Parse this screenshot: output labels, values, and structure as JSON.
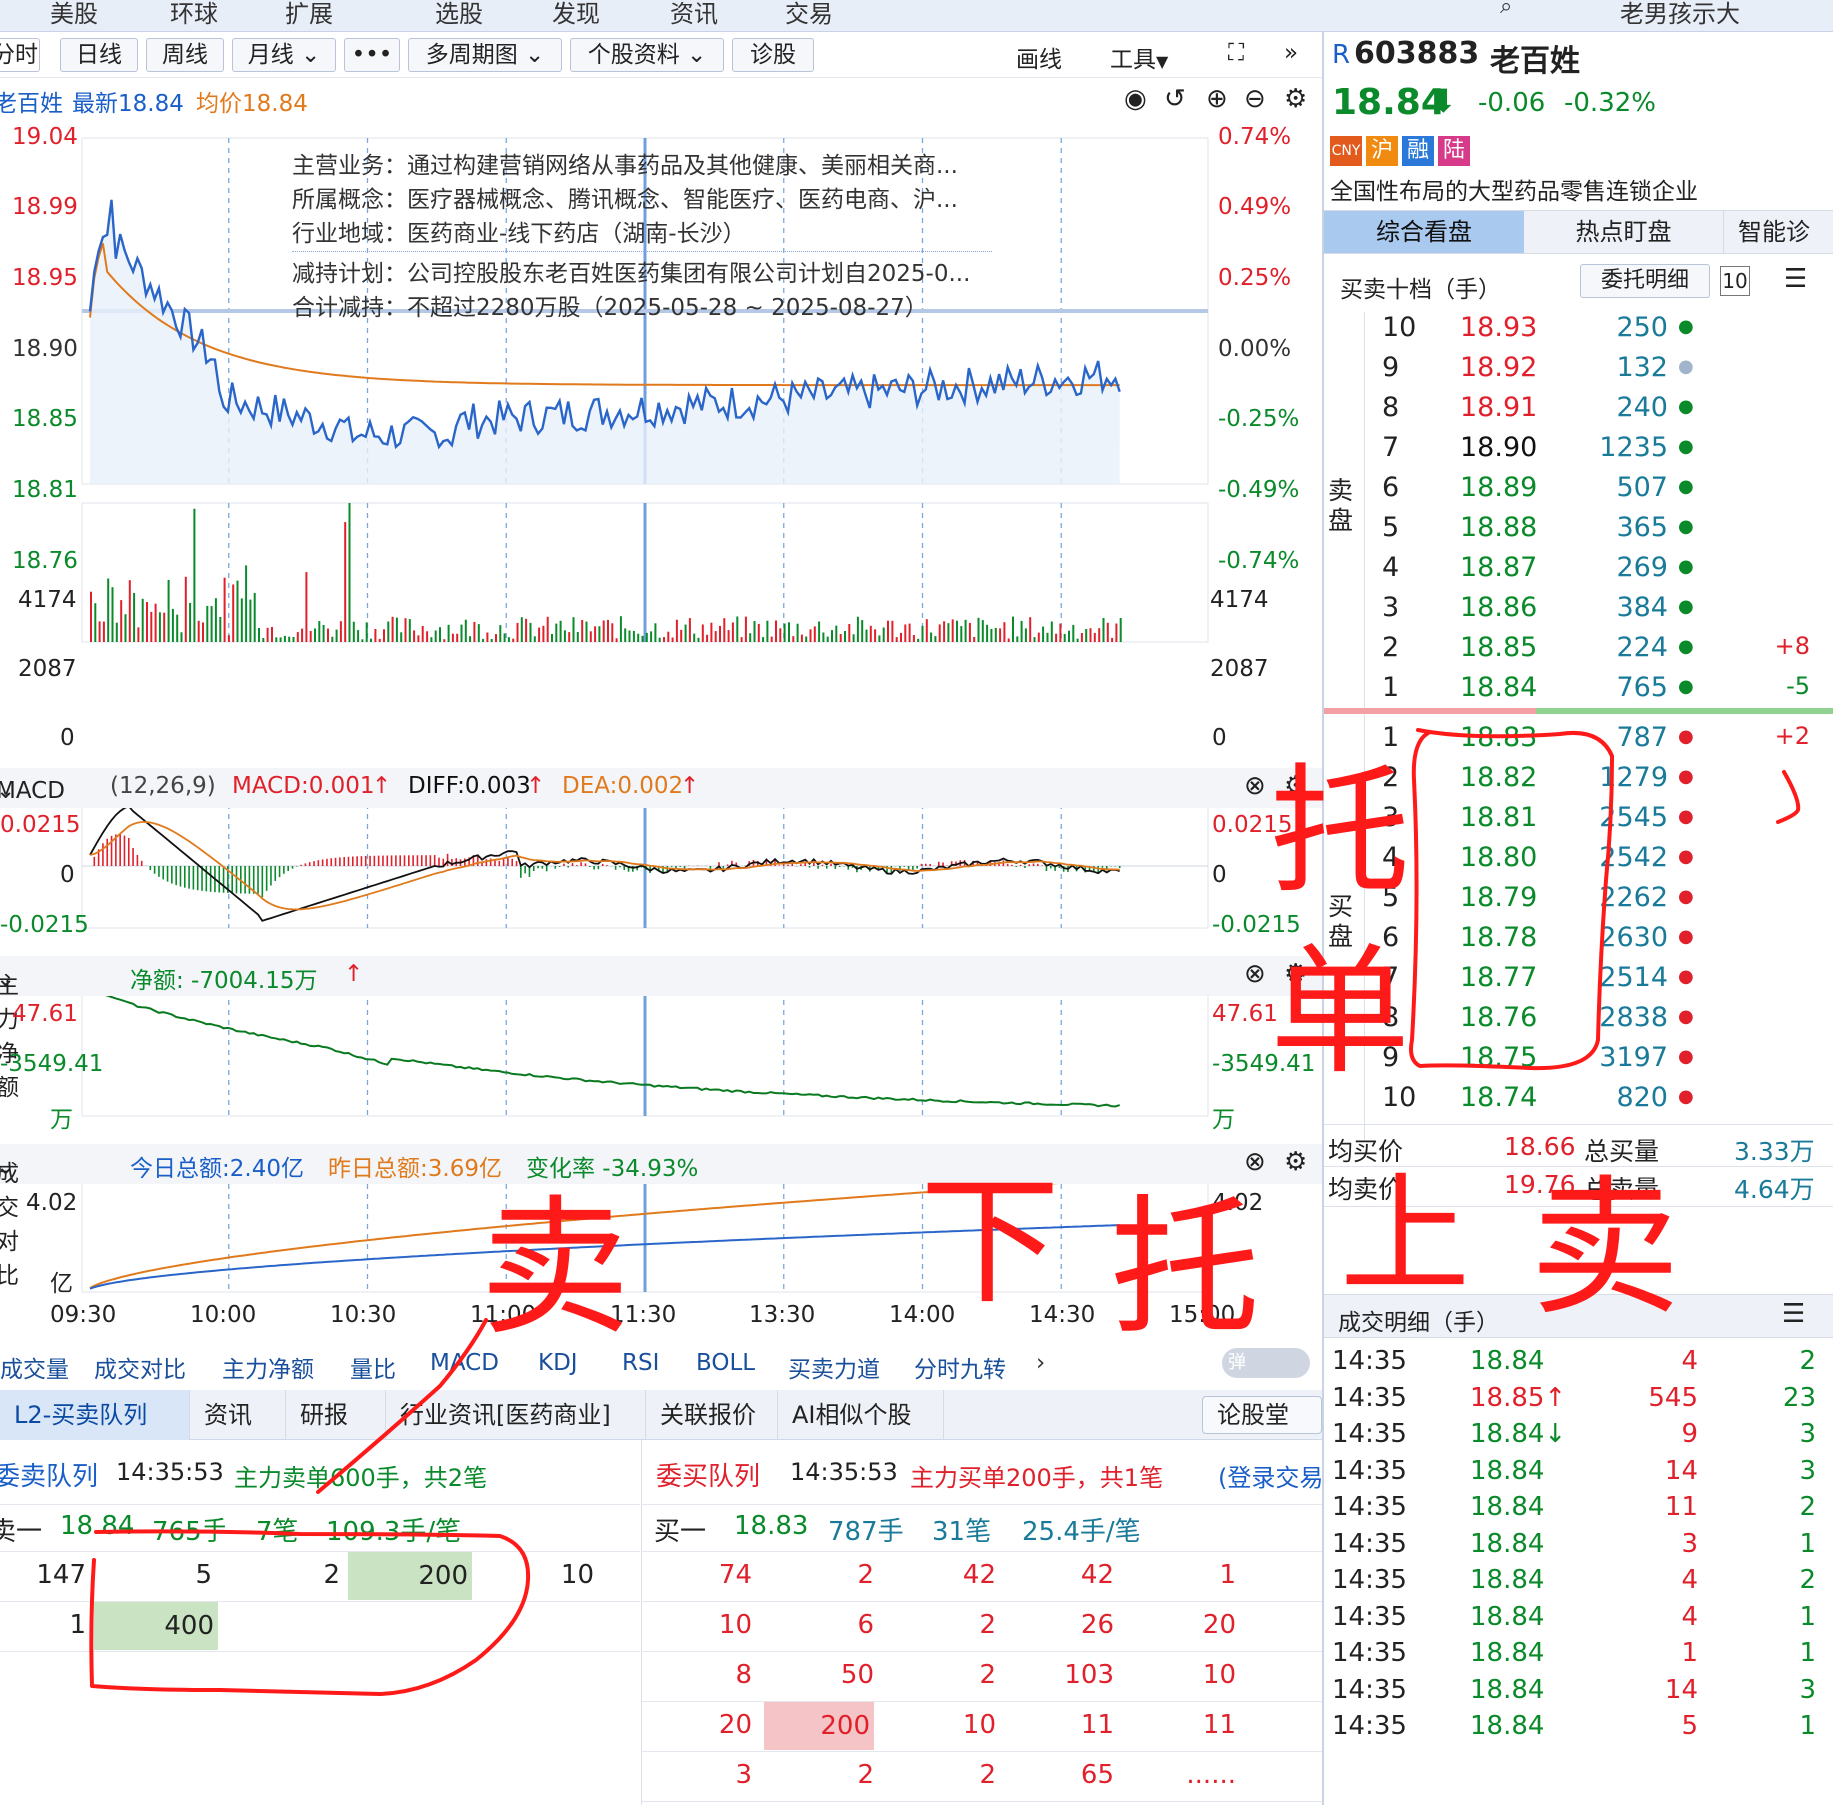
{
  "topnav": {
    "items": [
      "美股",
      "环球",
      "扩展",
      "选股",
      "发现",
      "资讯",
      "交易"
    ],
    "user": "老男孩示大"
  },
  "toolbar": {
    "buttons": [
      "分时",
      "日线",
      "周线",
      "月线",
      "•••",
      "多周期图",
      "个股资料",
      "诊股"
    ],
    "right": [
      "画线",
      "工具",
      "⛶",
      "»"
    ]
  },
  "quote_line": {
    "name": "老百姓",
    "latest": "最新18.84",
    "avg": "均价18.84"
  },
  "info_box": [
    "主营业务：通过构建营销网络从事药品及其他健康、美丽相关商...",
    "所属概念：医疗器械概念、腾讯概念、智能医疗、医药电商、沪...",
    "行业地域：医药商业-线下药店（湖南-长沙）",
    "减持计划：公司控股股东老百姓医药集团有限公司计划自2025-0...",
    "合计减持：不超过2280万股（2025-05-28 ~ 2025-08-27）"
  ],
  "price_axis_left": [
    "19.04",
    "18.99",
    "18.95",
    "18.90",
    "18.85",
    "18.81",
    "18.76"
  ],
  "price_axis_right": [
    "0.74%",
    "0.49%",
    "0.25%",
    "0.00%",
    "-0.25%",
    "-0.49%",
    "-0.74%"
  ],
  "volume_axis": [
    "4174",
    "2087",
    "0"
  ],
  "macd_bar": {
    "name": "MACD",
    "params": "(12,26,9)",
    "macd": "MACD:0.001",
    "diff": "DIFF:0.003",
    "dea": "DEA:0.002",
    "axis": [
      "0.0215",
      "0",
      "-0.0215"
    ]
  },
  "main_force_bar": {
    "name": "主力净额",
    "net": "净额:  -7004.15万",
    "axis_left": [
      "47.61",
      "-3549.41",
      "万"
    ],
    "axis_right": [
      "47.61",
      "-3549.41",
      "万"
    ]
  },
  "turnover_bar": {
    "name": "成交对比",
    "today": "今日总额:2.40亿",
    "yesterday": "昨日总额:3.69亿",
    "change": "变化率 -34.93%",
    "axis_left": [
      "4.02",
      "亿"
    ],
    "axis_right": [
      "4.02"
    ]
  },
  "time_axis": [
    "09:30",
    "10:00",
    "10:30",
    "11:00",
    "11:30",
    "13:30",
    "14:00",
    "14:30",
    "15:00"
  ],
  "indicator_tabs": [
    "成交量",
    "成交对比",
    "主力净额",
    "量比",
    "MACD",
    "KDJ",
    "RSI",
    "BOLL",
    "买卖力道",
    "分时九转"
  ],
  "bottom_tabs": [
    "L2-买卖队列",
    "资讯",
    "研报",
    "行业资讯[医药商业]",
    "关联报价",
    "AI相似个股",
    "论股堂"
  ],
  "sell_queue": {
    "title": "委卖队列",
    "time": "14:35:53",
    "note": "主力卖单600手，共2笔",
    "head": [
      "卖一",
      "18.84",
      "765手",
      "7笔",
      "109.3手/笔"
    ],
    "rows": [
      [
        "147",
        "5",
        "2",
        "200",
        "10"
      ],
      [
        "1",
        "400",
        "",
        "",
        ""
      ]
    ]
  },
  "buy_queue": {
    "title": "委买队列",
    "time": "14:35:53",
    "note": "主力买单200手，共1笔",
    "login": "(登录交易",
    "head": [
      "买一",
      "18.83",
      "787手",
      "31笔",
      "25.4手/笔"
    ],
    "rows": [
      [
        "74",
        "2",
        "42",
        "42",
        "1"
      ],
      [
        "10",
        "6",
        "2",
        "26",
        "20"
      ],
      [
        "8",
        "50",
        "2",
        "103",
        "10"
      ],
      [
        "20",
        "200",
        "10",
        "11",
        "11"
      ],
      [
        "3",
        "2",
        "2",
        "65",
        "......"
      ]
    ]
  },
  "stock": {
    "prefix": "R",
    "code": "603883",
    "name": "老百姓",
    "price": "18.84",
    "change": "-0.06",
    "pct": "-0.32%",
    "badges": [
      "CNY",
      "沪",
      "融",
      "陆"
    ],
    "desc": "全国性布局的大型药品零售连锁企业"
  },
  "right_tabs": [
    "综合看盘",
    "热点盯盘",
    "智能诊"
  ],
  "orderbook": {
    "title": "买卖十档（手）",
    "detail_btn": "委托明细",
    "depth": "10",
    "sell_label": "卖盘",
    "buy_label": "买盘",
    "sells": [
      [
        "10",
        "18.93",
        "250",
        ""
      ],
      [
        "9",
        "18.92",
        "132",
        ""
      ],
      [
        "8",
        "18.91",
        "240",
        ""
      ],
      [
        "7",
        "18.90",
        "1235",
        ""
      ],
      [
        "6",
        "18.89",
        "507",
        ""
      ],
      [
        "5",
        "18.88",
        "365",
        ""
      ],
      [
        "4",
        "18.87",
        "269",
        ""
      ],
      [
        "3",
        "18.86",
        "384",
        ""
      ],
      [
        "2",
        "18.85",
        "224",
        "+8"
      ],
      [
        "1",
        "18.84",
        "765",
        "-5"
      ]
    ],
    "buys": [
      [
        "1",
        "18.83",
        "787",
        "+2"
      ],
      [
        "2",
        "18.82",
        "1279",
        ""
      ],
      [
        "3",
        "18.81",
        "2545",
        ""
      ],
      [
        "4",
        "18.80",
        "2542",
        ""
      ],
      [
        "5",
        "18.79",
        "2262",
        ""
      ],
      [
        "6",
        "18.78",
        "2630",
        ""
      ],
      [
        "7",
        "18.77",
        "2514",
        ""
      ],
      [
        "8",
        "18.76",
        "2838",
        ""
      ],
      [
        "9",
        "18.75",
        "3197",
        ""
      ],
      [
        "10",
        "18.74",
        "820",
        ""
      ]
    ],
    "avg_buy_label": "均买价",
    "avg_buy": "18.66",
    "total_buy_label": "总买量",
    "total_buy": "3.33万",
    "avg_sell_label": "均卖价",
    "avg_sell": "19.76",
    "total_sell_label": "总卖量",
    "total_sell": "4.64万"
  },
  "trades": {
    "title": "成交明细（手）",
    "rows": [
      [
        "14:35",
        "18.84",
        "4",
        "2"
      ],
      [
        "14:35",
        "18.85↑",
        "545",
        "23"
      ],
      [
        "14:35",
        "18.84↓",
        "9",
        "3"
      ],
      [
        "14:35",
        "18.84",
        "14",
        "3"
      ],
      [
        "14:35",
        "18.84",
        "11",
        "2"
      ],
      [
        "14:35",
        "18.84",
        "3",
        "1"
      ],
      [
        "14:35",
        "18.84",
        "4",
        "2"
      ],
      [
        "14:35",
        "18.84",
        "4",
        "1"
      ],
      [
        "14:35",
        "18.84",
        "1",
        "1"
      ],
      [
        "14:35",
        "18.84",
        "14",
        "3"
      ],
      [
        "14:35",
        "18.84",
        "5",
        "1"
      ]
    ]
  },
  "handwriting": [
    "托",
    "单",
    "卖",
    "下",
    "托",
    "上",
    "卖"
  ],
  "colors": {
    "up": "#e0202a",
    "down": "#0a8a2a",
    "blue": "#1a5fc8",
    "orange": "#e07a1c",
    "accent": "#2a66c9"
  }
}
